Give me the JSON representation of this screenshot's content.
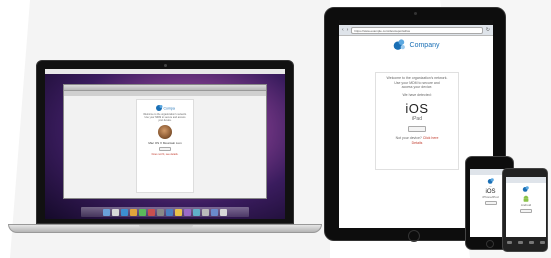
{
  "company": {
    "name": "Company"
  },
  "laptop": {
    "welcome_line1": "Welcome to the organization's network.",
    "welcome_line2": "Use your MDM to secure and access",
    "welcome_line3": "your device.",
    "os_label": "Mac OS X Mountain Lion",
    "button_label": "Install",
    "footer_text": "Does not fit, see details."
  },
  "tablet": {
    "url_text": "https://www.example.com/deviceportal/ios",
    "welcome_line1": "Welcome to the organization's network.",
    "welcome_line2": "Use your MDM to secure and",
    "welcome_line3": "access your device.",
    "detected_label": "We have detected:",
    "os_name": "iOS",
    "device_name": "iPad",
    "button_label": "Install",
    "help_text": "Not your device?",
    "help_link": "Click here",
    "note_text": "Details"
  },
  "phone1": {
    "os_name": "iOS",
    "device_name": "iPhone/iPod",
    "button_label": "Install"
  },
  "phone2": {
    "os_name": "Android",
    "button_label": "Install"
  },
  "colors": {
    "accent": "#1a6fb5",
    "link": "#c0392b"
  }
}
